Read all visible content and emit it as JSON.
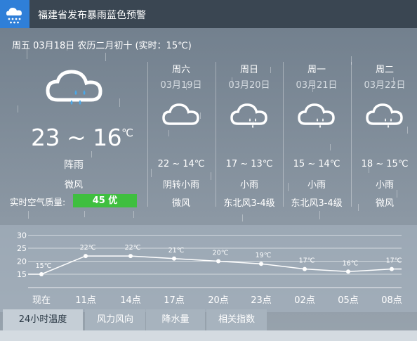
{
  "alert": {
    "title": "福建省发布暴雨蓝色预警",
    "icon": "rain-warning-icon",
    "icon_color": "#2f7fd8"
  },
  "today": {
    "date_line": "周五 03月18日 农历二月初十 (实时：15℃)",
    "icon": "cloud-rain-icon",
    "temp_range": "23 ~ 16",
    "temp_unit": "℃",
    "weather": "阵雨",
    "wind": "微风",
    "aqi_label": "实时空气质量:",
    "aqi_value": "45 优",
    "aqi_color": "#3fbf3f"
  },
  "forecast": [
    {
      "day": "周六",
      "date": "03月19日",
      "icon": "cloud-icon",
      "temp": "22 ~ 14℃",
      "weather": "阴转小雨",
      "wind": "微风"
    },
    {
      "day": "周日",
      "date": "03月20日",
      "icon": "cloud-rain-icon",
      "temp": "17 ~ 13℃",
      "weather": "小雨",
      "wind": "东北风3-4级"
    },
    {
      "day": "周一",
      "date": "03月21日",
      "icon": "cloud-rain-icon",
      "temp": "15 ~ 14℃",
      "weather": "小雨",
      "wind": "东北风3-4级"
    },
    {
      "day": "周二",
      "date": "03月22日",
      "icon": "cloud-rain-icon",
      "temp": "18 ~ 15℃",
      "weather": "小雨",
      "wind": "微风"
    }
  ],
  "chart_data": {
    "type": "line",
    "categories": [
      "现在",
      "11点",
      "14点",
      "17点",
      "20点",
      "23点",
      "02点",
      "05点",
      "08点"
    ],
    "series": [
      {
        "values": [
          15,
          22,
          22,
          21,
          20,
          19,
          17,
          16,
          17
        ]
      }
    ],
    "data_labels": [
      "15℃",
      "22℃",
      "22℃",
      "21℃",
      "20℃",
      "19℃",
      "17℃",
      "16℃",
      "17℃"
    ],
    "yticks": [
      15,
      20,
      25,
      30
    ],
    "ylim": [
      15,
      30
    ],
    "grid": true
  },
  "tabs": [
    {
      "label": "24小时温度",
      "active": true
    },
    {
      "label": "风力风向",
      "active": false
    },
    {
      "label": "降水量",
      "active": false
    },
    {
      "label": "相关指数",
      "active": false
    }
  ]
}
